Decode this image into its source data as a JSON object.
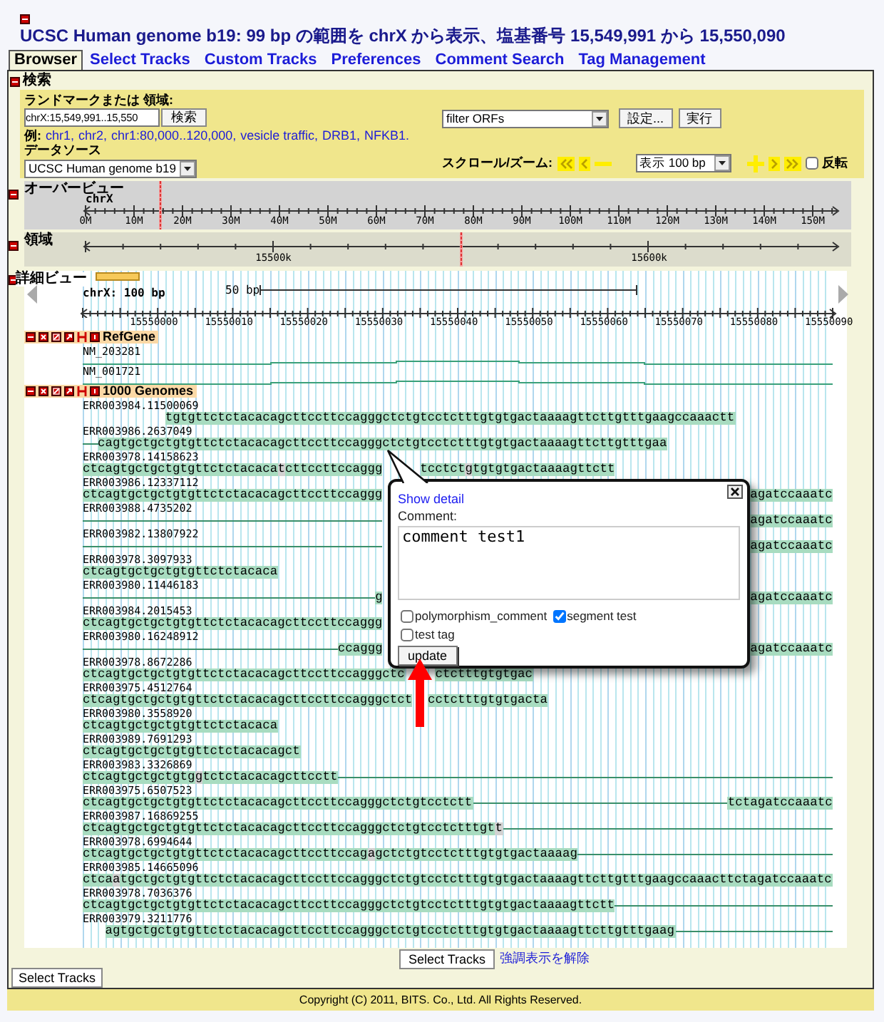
{
  "title": "UCSC Human genome b19: 99 bp の範囲を chrX から表示、塩基番号 15,549,991 から 15,550,090",
  "tabs": [
    {
      "label": "Browser",
      "selected": true
    },
    {
      "label": "Select Tracks",
      "selected": false
    },
    {
      "label": "Custom Tracks",
      "selected": false
    },
    {
      "label": "Preferences",
      "selected": false
    },
    {
      "label": "Comment Search",
      "selected": false
    },
    {
      "label": "Tag Management",
      "selected": false
    }
  ],
  "search": {
    "heading": "検索",
    "landmark_label": "ランドマークまたは 領域:",
    "landmark_value": "chrX:15,549,991..15,550",
    "search_button": "検索",
    "examples_label": "例:",
    "examples": [
      "chr1,",
      "chr2,",
      "chr1:80,000..120,000,",
      "vesicle traffic,",
      "DRB1,",
      "NFKB1."
    ],
    "datasource_label": "データソース",
    "datasource_value": "UCSC Human genome b19",
    "filter_value": "filter ORFs",
    "settings_button": "設定...",
    "run_button": "実行",
    "scroll_label": "スクロール/ズーム:",
    "zoom_value": "表示 100 bp",
    "flip": {
      "label": "反転",
      "checked": false
    }
  },
  "overview": {
    "heading": "オーバービュー",
    "chromosome": "chrX",
    "ticks": [
      "0M",
      "10M",
      "20M",
      "30M",
      "40M",
      "50M",
      "60M",
      "70M",
      "80M",
      "90M",
      "100M",
      "110M",
      "120M",
      "130M",
      "140M",
      "150M"
    ]
  },
  "region": {
    "heading": "領域",
    "ticks": [
      "15500k",
      "15600k"
    ]
  },
  "detail": {
    "heading": "詳細ビュー",
    "scale": "chrX: 100 bp",
    "scale_bar": "50 bp",
    "ticks": [
      "15550000",
      "15550010",
      "15550020",
      "15550030",
      "15550040",
      "15550050",
      "15550060",
      "15550070",
      "15550080",
      "15550090"
    ],
    "genes": {
      "name": "RefGene",
      "rows": [
        "NM_203281",
        "NM_001721"
      ]
    },
    "reads_track": {
      "name": "1000 Genomes",
      "reads": [
        {
          "name": "ERR003984.11500069",
          "pieces": [
            {
              "kind": "seq",
              "text": "           tgtgttctctacacagcttccttccagggctctgtcctctttgtgtgactaaaagttcttgtttgaagccaaactt"
            }
          ]
        },
        {
          "name": "ERR003986.2637049",
          "pieces": [
            {
              "kind": "line"
            },
            {
              "kind": "seq",
              "text": "cagtgctgctgtgttctctacacagcttccttccagggctctgtcctctttgtgtgactaaaagttcttgtttgaa                      "
            }
          ]
        },
        {
          "name": "ERR003978.14158623",
          "pieces": [
            {
              "kind": "seq",
              "text": "ctcagtgctgctgtgttctctacaca"
            },
            {
              "kind": "mismatch",
              "text": "t"
            },
            {
              "kind": "seq",
              "text": "cttccttccaggg"
            },
            {
              "kind": "seq",
              "text": "     tcctct"
            },
            {
              "kind": "mismatch",
              "text": "g"
            },
            {
              "kind": "seq",
              "text": "tgtgtgactaaaagttctt"
            }
          ]
        },
        {
          "name": "ERR003986.12337112",
          "pieces": [
            {
              "kind": "seq",
              "text": "ctcagtgctgctgtgttctctacacagcttccttccaggg"
            },
            {
              "kind": "seq",
              "text": "                                                 agatccaaatc"
            }
          ]
        },
        {
          "name": "ERR003988.4735202",
          "pieces": [
            {
              "kind": "line"
            },
            {
              "kind": "seq",
              "text": "                                                 agatccaaatc"
            }
          ]
        },
        {
          "name": "ERR003982.13807922",
          "pieces": [
            {
              "kind": "line"
            },
            {
              "kind": "seq",
              "text": "                                                 agatccaaatc"
            }
          ]
        },
        {
          "name": "ERR003978.3097933",
          "pieces": [
            {
              "kind": "seq",
              "text": "ctcagtgctgctgtgttctctacaca"
            }
          ]
        },
        {
          "name": "ERR003980.11446183",
          "pieces": [
            {
              "kind": "line"
            },
            {
              "kind": "seq",
              "text": "g"
            },
            {
              "kind": "seq",
              "text": "                                                 agatccaaatc"
            }
          ]
        },
        {
          "name": "ERR003984.2015453",
          "pieces": [
            {
              "kind": "seq",
              "text": "ctcagtgctgctgtgttctctacacagcttccttccaggg"
            }
          ]
        },
        {
          "name": "ERR003980.16248912",
          "pieces": [
            {
              "kind": "line"
            },
            {
              "kind": "seq",
              "text": "ccaggg"
            },
            {
              "kind": "seq",
              "text": "                                                 agatccaaatc"
            }
          ]
        },
        {
          "name": "ERR003978.8672286",
          "pieces": [
            {
              "kind": "seq",
              "text": "ctcagtgctgctgtgttctctacacagcttccttccagggctc"
            },
            {
              "kind": "seq",
              "text": "    ctctttgtgtgac"
            }
          ]
        },
        {
          "name": "ERR003975.4512764",
          "pieces": [
            {
              "kind": "seq",
              "text": "ctcagtgctgctgtgttctctacacagcttccttccagggctct"
            },
            {
              "kind": "seq",
              "text": "  cctctttgtgtgacta"
            }
          ]
        },
        {
          "name": "ERR003980.3558920",
          "pieces": [
            {
              "kind": "seq",
              "text": "ctcagtgctgctgtgttctctacaca"
            }
          ]
        },
        {
          "name": "ERR003989.7691293",
          "pieces": [
            {
              "kind": "seq",
              "text": "ctcagtgctgctgtgttctctacacagct"
            }
          ]
        },
        {
          "name": "ERR003983.3326869",
          "pieces": [
            {
              "kind": "seq",
              "text": "ctcagtgctgctgtg"
            },
            {
              "kind": "mismatch",
              "text": "g"
            },
            {
              "kind": "seq",
              "text": "tctctacacagcttcctt"
            },
            {
              "kind": "line"
            }
          ]
        },
        {
          "name": "ERR003975.6507523",
          "pieces": [
            {
              "kind": "seq",
              "text": "ctcagtgctgctgtgttctctacacagcttccttccagggctctgtcctctt"
            },
            {
              "kind": "line"
            },
            {
              "kind": "seq",
              "text": "tctagatccaaatc"
            }
          ]
        },
        {
          "name": "ERR003987.16869255",
          "pieces": [
            {
              "kind": "seq",
              "text": "ctcagtgctgctgtgttctctacacagcttccttccagggctctgtcctctttgt"
            },
            {
              "kind": "mismatch",
              "text": "t"
            },
            {
              "kind": "line"
            }
          ]
        },
        {
          "name": "ERR003978.6994644",
          "pieces": [
            {
              "kind": "seq",
              "text": "ctcagtgctgctgtgttctctacacagcttccttccag"
            },
            {
              "kind": "mismatch",
              "text": "a"
            },
            {
              "kind": "seq",
              "text": "gctctgtcctctttgtgtgactaaaag"
            },
            {
              "kind": "line"
            }
          ]
        },
        {
          "name": "ERR003985.14665096",
          "pieces": [
            {
              "kind": "seq",
              "text": "ctca"
            },
            {
              "kind": "mismatch",
              "text": "a"
            },
            {
              "kind": "seq",
              "text": "tgctgctgtgttctctacacagcttccttccagggctctgtcctctttgtgtgactaaaagttcttgtttgaagccaaacttctagatccaaatc"
            }
          ]
        },
        {
          "name": "ERR003978.7036376",
          "pieces": [
            {
              "kind": "seq",
              "text": "ctcagtgctgctgtgttctctacacagcttccttccagggctctgtcctctttgtgtgactaaaagttctt"
            },
            {
              "kind": "line"
            }
          ]
        },
        {
          "name": "ERR003979.3211776",
          "pieces": [
            {
              "kind": "seq",
              "text": "   agtgctgctgtgttctctacacagcttccttccagggctctgtcctctttgtgtgactaaaagttcttgtttgaag"
            },
            {
              "kind": "line"
            }
          ]
        }
      ]
    }
  },
  "popup": {
    "link": "Show detail",
    "comment_label": "Comment:",
    "comment": "comment test1",
    "tags": [
      {
        "label": "polymorphism_comment",
        "checked": false
      },
      {
        "label": "segment test",
        "checked": true
      },
      {
        "label": "test tag",
        "checked": false
      }
    ],
    "button": "update"
  },
  "select_tracks_button": "Select Tracks",
  "clear_highlight_link": "強調表示を解除",
  "bottom_tab": "Select Tracks",
  "footer": "Copyright (C) 2011, BITS. Co., Ltd. All Rights Reserved."
}
